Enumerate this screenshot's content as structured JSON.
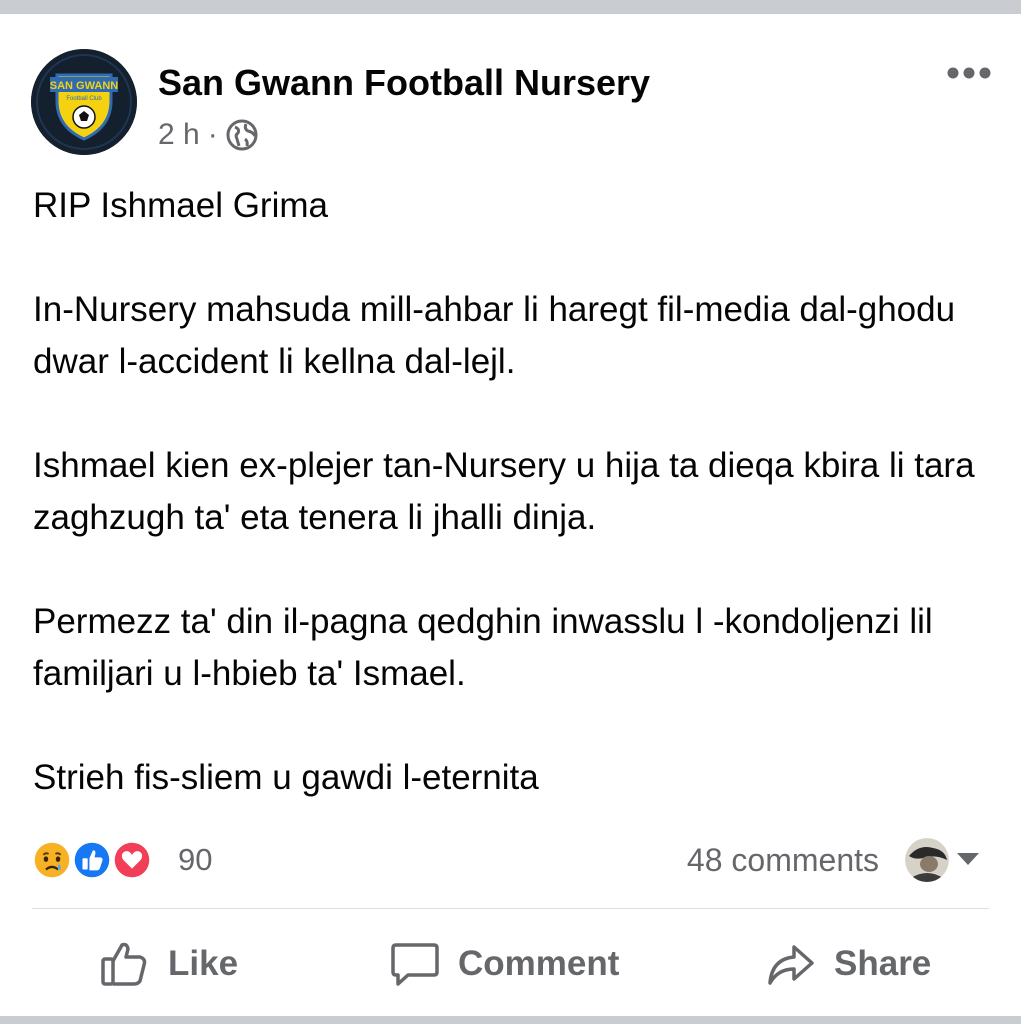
{
  "post": {
    "page_name": "San Gwann Football Nursery",
    "avatar": {
      "icon": "club-crest-icon",
      "crest_text": "SAN GWANN",
      "crest_subtext": "Football Club",
      "colors": {
        "background": "#14202e",
        "shield": "#f5d20f",
        "ring": "#2e6bb3"
      }
    },
    "time": "2 h",
    "separator": "·",
    "audience_icon": "globe-icon",
    "more_icon": "more-options-icon",
    "paragraphs": [
      "RIP Ishmael Grima",
      "In-Nursery mahsuda mill-ahbar li haregt fil-media dal-ghodu dwar l-accident li kellna dal-lejl.",
      "Ishmael kien ex-plejer tan-Nursery u hija ta dieqa kbira li tara zaghzugh ta' eta tenera li jhalli dinja.",
      "Permezz ta' din il-pagna qedghin inwasslu l -kondoljenzi lil familjari u l-hbieb ta' Ismael.",
      "Strieh fis-sliem u gawdi l-eternita"
    ],
    "reactions": {
      "icons": [
        "sad-reaction-icon",
        "like-reaction-icon",
        "love-reaction-icon"
      ],
      "count": "90"
    },
    "comments_label": "48 comments",
    "actions": {
      "like": "Like",
      "comment": "Comment",
      "share": "Share"
    },
    "colors": {
      "text": "#050505",
      "secondary_text": "#65676b",
      "like_blue": "#1877f2",
      "love_red": "#f33e58",
      "sad_yellow": "#f7b125",
      "divider": "#dadde1"
    }
  }
}
